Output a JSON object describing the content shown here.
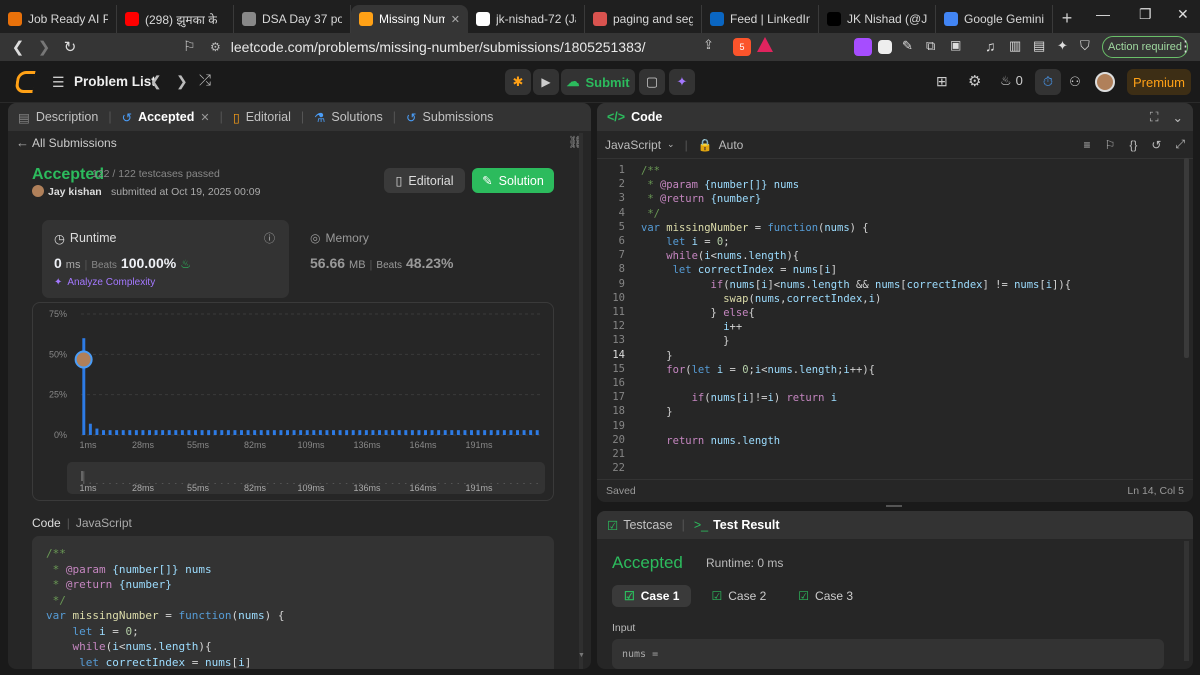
{
  "browser": {
    "tabs": [
      {
        "label": "Job Ready AI Pow",
        "icon": "job-icon",
        "color": "#e8710a"
      },
      {
        "label": "(298) झुमका के",
        "icon": "youtube-icon",
        "color": "#ff0000"
      },
      {
        "label": "DSA Day 37 post",
        "icon": "chatgpt-icon",
        "color": "#888888"
      },
      {
        "label": "Missing Numb",
        "icon": "leetcode-icon",
        "color": "#ffa116"
      },
      {
        "label": "jk-nishad-72 (Jay",
        "icon": "github-icon",
        "color": "#ffffff"
      },
      {
        "label": "paging and segme",
        "icon": "record-icon",
        "color": "#d9534f"
      },
      {
        "label": "Feed | LinkedIn",
        "icon": "linkedin-icon",
        "color": "#0a66c2"
      },
      {
        "label": "JK Nishad (@JKNi",
        "icon": "x-icon",
        "color": "#000000"
      },
      {
        "label": "Google Gemini",
        "icon": "gemini-icon",
        "color": "#4285f4"
      }
    ],
    "url": "leetcode.com/problems/missing-number/submissions/1805251383/",
    "brave_badge": "5",
    "action_required": "Action required"
  },
  "leetcode_nav": {
    "problem_list": "Problem List",
    "submit": "Submit",
    "streak": "0",
    "premium": "Premium"
  },
  "left_panel": {
    "tabs": {
      "description": "Description",
      "accepted": "Accepted",
      "editorial": "Editorial",
      "solutions": "Solutions",
      "submissions": "Submissions"
    },
    "back": "All Submissions",
    "status": "Accepted",
    "testcases": "122 / 122 testcases passed",
    "author": "Jay kishan",
    "submitted_text": "submitted at Oct 19, 2025 00:09",
    "editorial_btn": "Editorial",
    "solution_btn": "Solution",
    "runtime": {
      "label": "Runtime",
      "value": "0",
      "unit": "ms",
      "beats_label": "Beats",
      "beats": "100.00%",
      "analyze": "Analyze Complexity"
    },
    "memory": {
      "label": "Memory",
      "value": "56.66",
      "unit": "MB",
      "beats_label": "Beats",
      "beats": "48.23%"
    },
    "code_header": {
      "label": "Code",
      "lang": "JavaScript"
    },
    "code_preview": [
      "/**",
      " * @param {number[]} nums",
      " * @return {number}",
      " */",
      "var missingNumber = function(nums) {",
      "    let i = 0;",
      "    while(i<nums.length){",
      "     let correctIndex = nums[i]"
    ]
  },
  "chart_data": {
    "type": "bar",
    "y_ticks": [
      "75%",
      "50%",
      "25%",
      "0%"
    ],
    "ylim": [
      0,
      75
    ],
    "x_ticks": [
      "1ms",
      "28ms",
      "55ms",
      "82ms",
      "109ms",
      "136ms",
      "164ms",
      "191ms"
    ],
    "values": [
      60,
      7,
      4,
      3,
      3,
      3,
      3,
      3,
      3,
      3,
      3,
      3,
      3,
      3,
      3,
      3,
      3,
      3,
      3,
      3,
      3,
      3,
      3,
      3,
      3,
      3,
      3,
      3,
      3,
      3,
      3,
      3,
      3,
      3,
      3,
      3,
      3,
      3,
      3,
      3,
      3,
      3,
      3,
      3,
      3,
      3,
      3,
      3,
      3,
      3,
      3,
      3,
      3,
      3,
      3,
      3,
      3,
      3,
      3,
      3,
      3,
      3,
      3,
      3,
      3,
      3,
      3,
      3,
      3,
      3
    ],
    "highlight_index": 0,
    "bar_color": "#2d7be5",
    "grid": true
  },
  "code_panel": {
    "title": "Code",
    "language": "JavaScript",
    "auto": "Auto",
    "status": "Saved",
    "cursor": "Ln 14, Col 5",
    "active_line": 14,
    "lines": [
      "/**",
      " * @param {number[]} nums",
      " * @return {number}",
      " */",
      "var missingNumber = function(nums) {",
      "    let i = 0;",
      "    while(i<nums.length){",
      "     let correctIndex = nums[i]",
      "           if(nums[i]<nums.length && nums[correctIndex] != nums[i]){",
      "             swap(nums,correctIndex,i)",
      "           } else{",
      "             i++",
      "             }",
      "    }",
      "    for(let i = 0;i<nums.length;i++){",
      "",
      "        if(nums[i]!=i) return i",
      "    }",
      "",
      "    return nums.length",
      "",
      ""
    ]
  },
  "result_panel": {
    "testcase_tab": "Testcase",
    "result_tab": "Test Result",
    "status": "Accepted",
    "runtime": "Runtime: 0 ms",
    "cases": [
      "Case 1",
      "Case 2",
      "Case 3"
    ],
    "input_label": "Input",
    "input_value": "nums ="
  }
}
